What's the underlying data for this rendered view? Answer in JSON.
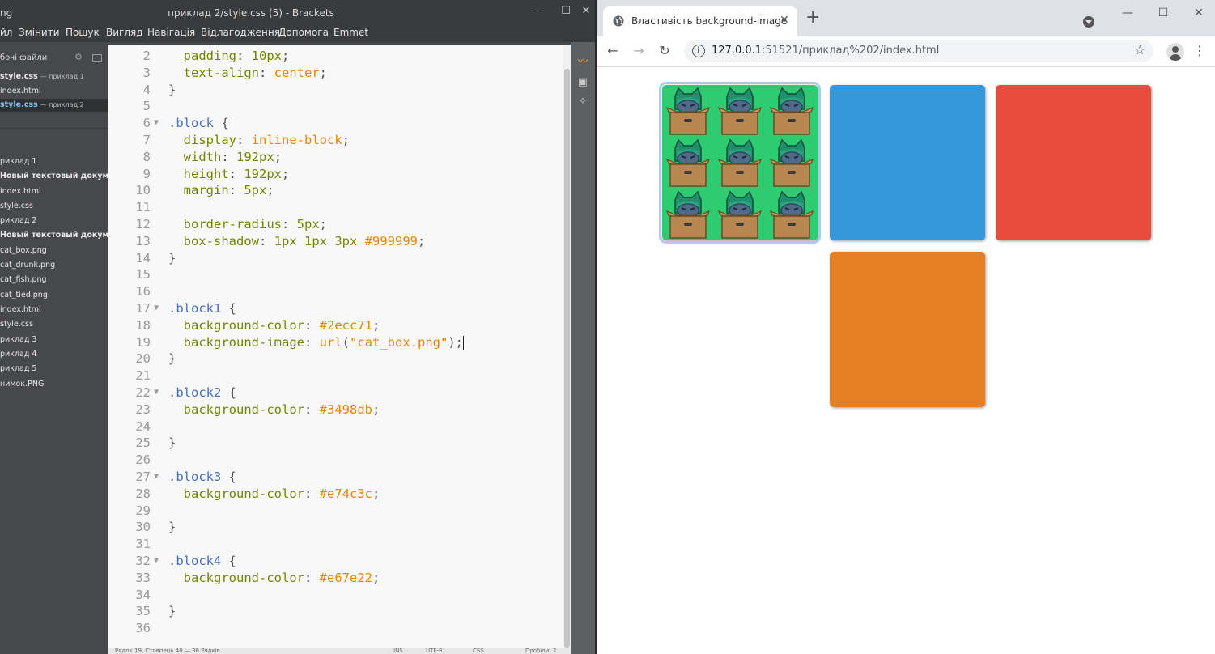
{
  "brackets": {
    "app_fragment": "ng",
    "title": "приклад 2/style.css (5) - Brackets",
    "menu": [
      "йл",
      "Змінити",
      "Пошук",
      "Вигляд",
      "Навігація",
      "Відлагодження",
      "Допомога",
      "Emmet"
    ],
    "working_files_header": "бочі файли",
    "working_files": [
      {
        "name": "style.css",
        "dir": "— приклад 1"
      },
      {
        "name": "index.html",
        "dir": ""
      },
      {
        "name": "style.css",
        "dir": "— приклад 2"
      }
    ],
    "tree": [
      {
        "label": "риклад 1",
        "bold": false
      },
      {
        "label": "Новый текстовый документ",
        "bold": true
      },
      {
        "label": "index.html",
        "bold": false
      },
      {
        "label": "style.css",
        "bold": false
      },
      {
        "label": "риклад 2",
        "bold": false
      },
      {
        "label": "Новый текстовый документ",
        "bold": true
      },
      {
        "label": "cat_box.png",
        "bold": false
      },
      {
        "label": "cat_drunk.png",
        "bold": false
      },
      {
        "label": "cat_fish.png",
        "bold": false
      },
      {
        "label": "cat_tied.png",
        "bold": false
      },
      {
        "label": "index.html",
        "bold": false
      },
      {
        "label": "style.css",
        "bold": false
      },
      {
        "label": "риклад 3",
        "bold": false
      },
      {
        "label": "риклад 4",
        "bold": false
      },
      {
        "label": "риклад 5",
        "bold": false
      },
      {
        "label": "нимок.PNG",
        "bold": false
      }
    ],
    "code_lines": [
      {
        "n": "2",
        "fold": "",
        "tokens": [
          [
            "  ",
            ""
          ],
          [
            "padding",
            "t-prop"
          ],
          [
            ": ",
            "t-pun"
          ],
          [
            "10px",
            "t-num"
          ],
          [
            ";",
            "t-pun"
          ]
        ]
      },
      {
        "n": "3",
        "fold": "",
        "tokens": [
          [
            "  ",
            ""
          ],
          [
            "text-align",
            "t-prop"
          ],
          [
            ": ",
            "t-pun"
          ],
          [
            "center",
            "t-kw"
          ],
          [
            ";",
            "t-pun"
          ]
        ]
      },
      {
        "n": "4",
        "fold": "",
        "tokens": [
          [
            "}",
            "t-pun"
          ]
        ]
      },
      {
        "n": "5",
        "fold": "",
        "tokens": []
      },
      {
        "n": "6",
        "fold": "▼",
        "tokens": [
          [
            ".block",
            "t-sel"
          ],
          [
            " {",
            "t-pun"
          ]
        ]
      },
      {
        "n": "7",
        "fold": "",
        "tokens": [
          [
            "  ",
            ""
          ],
          [
            "display",
            "t-prop"
          ],
          [
            ": ",
            "t-pun"
          ],
          [
            "inline-block",
            "t-kw"
          ],
          [
            ";",
            "t-pun"
          ]
        ]
      },
      {
        "n": "8",
        "fold": "",
        "tokens": [
          [
            "  ",
            ""
          ],
          [
            "width",
            "t-prop"
          ],
          [
            ": ",
            "t-pun"
          ],
          [
            "192px",
            "t-num"
          ],
          [
            ";",
            "t-pun"
          ]
        ]
      },
      {
        "n": "9",
        "fold": "",
        "tokens": [
          [
            "  ",
            ""
          ],
          [
            "height",
            "t-prop"
          ],
          [
            ": ",
            "t-pun"
          ],
          [
            "192px",
            "t-num"
          ],
          [
            ";",
            "t-pun"
          ]
        ]
      },
      {
        "n": "10",
        "fold": "",
        "tokens": [
          [
            "  ",
            ""
          ],
          [
            "margin",
            "t-prop"
          ],
          [
            ": ",
            "t-pun"
          ],
          [
            "5px",
            "t-num"
          ],
          [
            ";",
            "t-pun"
          ]
        ]
      },
      {
        "n": "11",
        "fold": "",
        "tokens": []
      },
      {
        "n": "12",
        "fold": "",
        "tokens": [
          [
            "  ",
            ""
          ],
          [
            "border-radius",
            "t-prop"
          ],
          [
            ": ",
            "t-pun"
          ],
          [
            "5px",
            "t-num"
          ],
          [
            ";",
            "t-pun"
          ]
        ]
      },
      {
        "n": "13",
        "fold": "",
        "tokens": [
          [
            "  ",
            ""
          ],
          [
            "box-shadow",
            "t-prop"
          ],
          [
            ": ",
            "t-pun"
          ],
          [
            "1px 1px 3px ",
            "t-num"
          ],
          [
            "#999999",
            "t-hex"
          ],
          [
            ";",
            "t-pun"
          ]
        ]
      },
      {
        "n": "14",
        "fold": "",
        "tokens": [
          [
            "}",
            "t-pun"
          ]
        ]
      },
      {
        "n": "15",
        "fold": "",
        "tokens": []
      },
      {
        "n": "16",
        "fold": "",
        "tokens": []
      },
      {
        "n": "17",
        "fold": "▼",
        "tokens": [
          [
            ".block1",
            "t-sel"
          ],
          [
            " {",
            "t-pun"
          ]
        ]
      },
      {
        "n": "18",
        "fold": "",
        "tokens": [
          [
            "  ",
            ""
          ],
          [
            "background-color",
            "t-prop"
          ],
          [
            ": ",
            "t-pun"
          ],
          [
            "#2ecc71",
            "t-hex"
          ],
          [
            ";",
            "t-pun"
          ]
        ]
      },
      {
        "n": "19",
        "fold": "",
        "tokens": [
          [
            "  ",
            ""
          ],
          [
            "background-image",
            "t-prop"
          ],
          [
            ": ",
            "t-pun"
          ],
          [
            "url",
            "t-kw"
          ],
          [
            "(",
            "t-pun"
          ],
          [
            "\"cat_box.png\"",
            "t-str"
          ],
          [
            ");",
            "t-pun"
          ],
          [
            "|CURSOR|",
            ""
          ]
        ]
      },
      {
        "n": "20",
        "fold": "",
        "tokens": [
          [
            "}",
            "t-pun"
          ]
        ]
      },
      {
        "n": "21",
        "fold": "",
        "tokens": []
      },
      {
        "n": "22",
        "fold": "▼",
        "tokens": [
          [
            ".block2",
            "t-sel"
          ],
          [
            " {",
            "t-pun"
          ]
        ]
      },
      {
        "n": "23",
        "fold": "",
        "tokens": [
          [
            "  ",
            ""
          ],
          [
            "background-color",
            "t-prop"
          ],
          [
            ": ",
            "t-pun"
          ],
          [
            "#3498db",
            "t-hex"
          ],
          [
            ";",
            "t-pun"
          ]
        ]
      },
      {
        "n": "24",
        "fold": "",
        "tokens": []
      },
      {
        "n": "25",
        "fold": "",
        "tokens": [
          [
            "}",
            "t-pun"
          ]
        ]
      },
      {
        "n": "26",
        "fold": "",
        "tokens": []
      },
      {
        "n": "27",
        "fold": "▼",
        "tokens": [
          [
            ".block3",
            "t-sel"
          ],
          [
            " {",
            "t-pun"
          ]
        ]
      },
      {
        "n": "28",
        "fold": "",
        "tokens": [
          [
            "  ",
            ""
          ],
          [
            "background-color",
            "t-prop"
          ],
          [
            ": ",
            "t-pun"
          ],
          [
            "#e74c3c",
            "t-hex"
          ],
          [
            ";",
            "t-pun"
          ]
        ]
      },
      {
        "n": "29",
        "fold": "",
        "tokens": []
      },
      {
        "n": "30",
        "fold": "",
        "tokens": [
          [
            "}",
            "t-pun"
          ]
        ]
      },
      {
        "n": "31",
        "fold": "",
        "tokens": []
      },
      {
        "n": "32",
        "fold": "▼",
        "tokens": [
          [
            ".block4",
            "t-sel"
          ],
          [
            " {",
            "t-pun"
          ]
        ]
      },
      {
        "n": "33",
        "fold": "",
        "tokens": [
          [
            "  ",
            ""
          ],
          [
            "background-color",
            "t-prop"
          ],
          [
            ": ",
            "t-pun"
          ],
          [
            "#e67e22",
            "t-hex"
          ],
          [
            ";",
            "t-pun"
          ]
        ]
      },
      {
        "n": "34",
        "fold": "",
        "tokens": []
      },
      {
        "n": "35",
        "fold": "",
        "tokens": [
          [
            "}",
            "t-pun"
          ]
        ]
      },
      {
        "n": "36",
        "fold": "",
        "tokens": []
      }
    ],
    "status": {
      "left": "Рядок 19, Стовпець 40 — 36 Рядків",
      "ins": "INS",
      "enc": "UTF-8",
      "lang": "CSS",
      "spaces": "Пробіли: 2"
    }
  },
  "chrome": {
    "tab_title": "Властивість background-image",
    "url_host": "127.0.0.1",
    "url_rest": ":51521/приклад%202/index.html",
    "blocks": [
      {
        "id": "block1",
        "color": "#2ecc71",
        "image": "cat_box.png"
      },
      {
        "id": "block2",
        "color": "#3498db"
      },
      {
        "id": "block3",
        "color": "#e74c3c"
      },
      {
        "id": "block4",
        "color": "#e67e22"
      }
    ]
  },
  "icons": {
    "globe": "globe-icon",
    "close": "close-icon",
    "plus": "new-tab-icon",
    "back": "back-icon",
    "forward": "forward-icon",
    "reload": "reload-icon",
    "info": "info-icon",
    "star": "bookmark-star-icon",
    "profile": "profile-icon",
    "menu": "menu-icon"
  }
}
